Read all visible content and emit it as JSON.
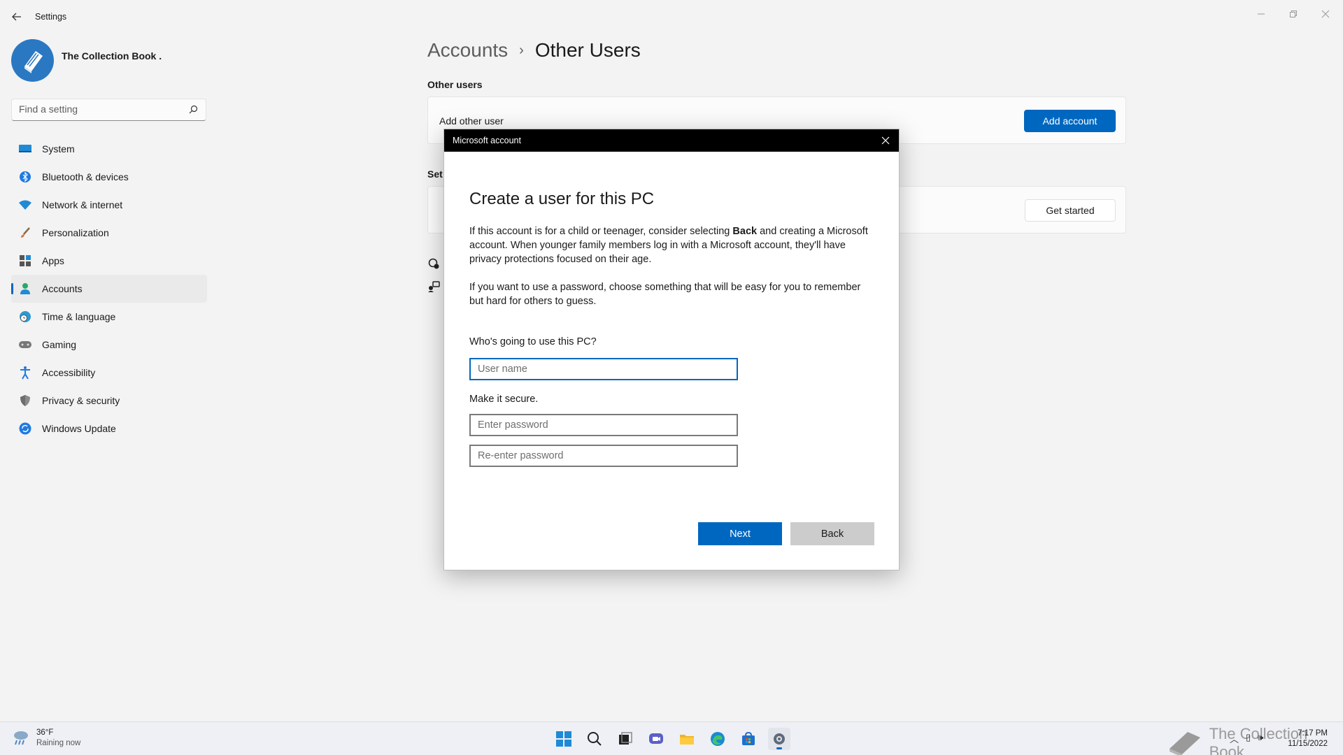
{
  "window": {
    "title": "Settings",
    "controls": {
      "minimize": "—",
      "maximize": "❐",
      "close": "✕"
    }
  },
  "profile": {
    "name": "The Collection Book ."
  },
  "search": {
    "placeholder": "Find a setting"
  },
  "nav": {
    "items": [
      {
        "label": "System",
        "icon": "monitor-icon"
      },
      {
        "label": "Bluetooth & devices",
        "icon": "bluetooth-icon"
      },
      {
        "label": "Network & internet",
        "icon": "wifi-icon"
      },
      {
        "label": "Personalization",
        "icon": "brush-icon"
      },
      {
        "label": "Apps",
        "icon": "apps-icon"
      },
      {
        "label": "Accounts",
        "icon": "person-icon",
        "active": true
      },
      {
        "label": "Time & language",
        "icon": "globe-clock-icon"
      },
      {
        "label": "Gaming",
        "icon": "gamepad-icon"
      },
      {
        "label": "Accessibility",
        "icon": "accessibility-icon"
      },
      {
        "label": "Privacy & security",
        "icon": "shield-icon"
      },
      {
        "label": "Windows Update",
        "icon": "update-icon"
      }
    ]
  },
  "main": {
    "breadcrumb": {
      "parent": "Accounts",
      "separator": "›",
      "current": "Other Users"
    },
    "section_title": "Other users",
    "add_other_user_label": "Add other user",
    "add_account_button": "Add account",
    "section2_title_partial": "Set",
    "get_started_button": "Get started"
  },
  "dialog": {
    "title": "Microsoft account",
    "heading": "Create a user for this PC",
    "para1_part1": "If this account is for a child or teenager, consider selecting ",
    "para1_bold": "Back",
    "para1_part2": " and creating a Microsoft account. When younger family members log in with a Microsoft account, they'll have privacy protections focused on their age.",
    "para2": "If you want to use a password, choose something that will be easy for you to remember but hard for others to guess.",
    "who_label": "Who's going to use this PC?",
    "username_placeholder": "User name",
    "secure_label": "Make it secure.",
    "password_placeholder": "Enter password",
    "reenter_placeholder": "Re-enter password",
    "next_button": "Next",
    "back_button": "Back"
  },
  "taskbar": {
    "weather_temp": "36°F",
    "weather_desc": "Raining now",
    "watermark": "The Collection Book",
    "time": "7:17 PM",
    "date": "11/15/2022",
    "apps": [
      "windows-start-icon",
      "search-icon",
      "task-view-icon",
      "chat-icon",
      "file-explorer-icon",
      "edge-icon",
      "store-icon",
      "settings-icon"
    ]
  },
  "colors": {
    "accent": "#0067c0",
    "background": "#f3f3f3",
    "dialog_header": "#000000"
  }
}
